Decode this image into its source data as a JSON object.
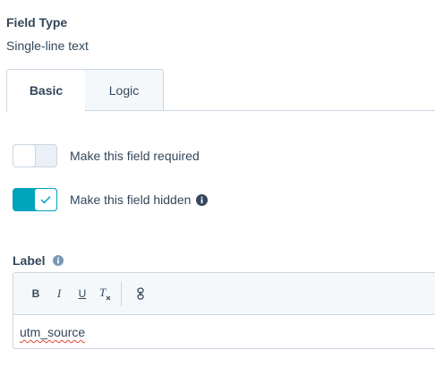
{
  "field_type": {
    "heading": "Field Type",
    "value": "Single-line text"
  },
  "tabs": [
    {
      "label": "Basic",
      "active": true
    },
    {
      "label": "Logic",
      "active": false
    }
  ],
  "toggles": {
    "required": {
      "label": "Make this field required",
      "checked": false
    },
    "hidden": {
      "label": "Make this field hidden",
      "checked": true,
      "icon": "info-icon"
    }
  },
  "label_field": {
    "heading": "Label",
    "icon": "info-icon",
    "toolbar": {
      "bold": "B",
      "italic": "I",
      "underline": "U",
      "clear_format": "T"
    },
    "value": "utm_source"
  },
  "colors": {
    "accent": "#00a4bd",
    "text": "#33475b",
    "border": "#cbd6e2",
    "spellcheck": "#e0453a"
  }
}
